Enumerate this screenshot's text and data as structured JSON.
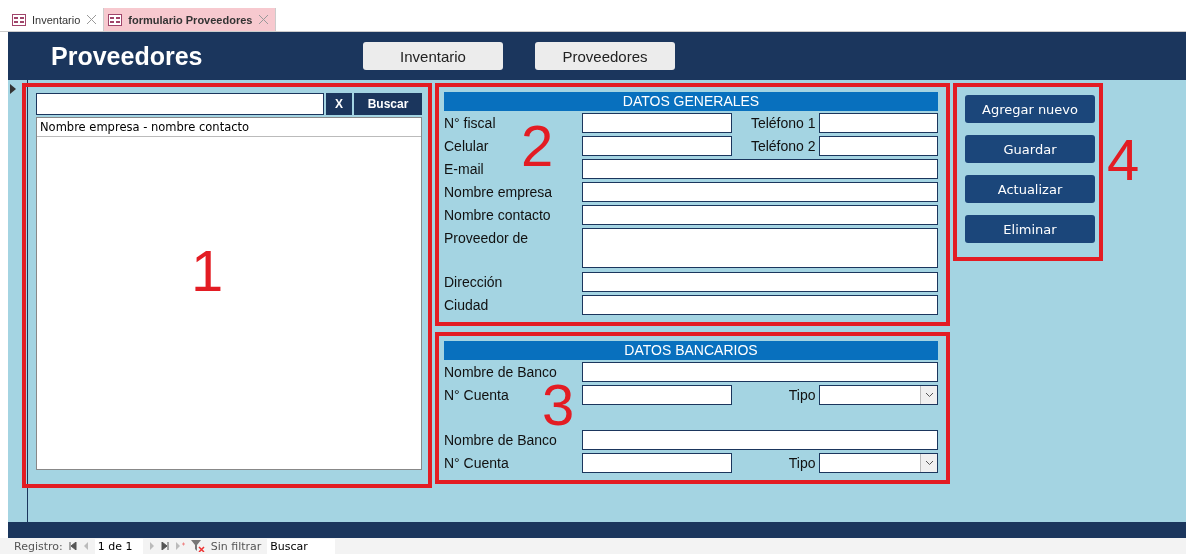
{
  "tabs": [
    {
      "label": "Inventario",
      "selected": false
    },
    {
      "label": "formulario Proveedores",
      "selected": true
    }
  ],
  "header": {
    "title": "Proveedores",
    "nav_buttons": [
      "Inventario",
      "Proveedores"
    ]
  },
  "search_panel": {
    "annotation": "1",
    "clear_button": "X",
    "search_button": "Buscar",
    "list_header": "Nombre empresa - nombre contacto"
  },
  "general": {
    "annotation": "2",
    "title": "DATOS GENERALES",
    "rows": [
      [
        {
          "label": "N° fiscal",
          "kind": "short"
        },
        {
          "label": "Teléfono 1",
          "kind": "short"
        }
      ],
      [
        {
          "label": "Celular",
          "kind": "short"
        },
        {
          "label": "Teléfono 2",
          "kind": "short"
        }
      ],
      [
        {
          "label": "E-mail",
          "kind": "long"
        }
      ],
      [
        {
          "label": "Nombre empresa",
          "kind": "long"
        }
      ],
      [
        {
          "label": "Nombre contacto",
          "kind": "long"
        }
      ],
      [
        {
          "label": "Proveedor de",
          "kind": "multiline"
        }
      ],
      [
        {
          "label": "Dirección",
          "kind": "long"
        }
      ],
      [
        {
          "label": "Ciudad",
          "kind": "long"
        }
      ]
    ]
  },
  "bank": {
    "annotation": "3",
    "title": "DATOS BANCARIOS",
    "groups": [
      [
        [
          {
            "label": "Nombre de Banco",
            "kind": "long"
          }
        ],
        [
          {
            "label": "N° Cuenta",
            "kind": "short"
          },
          {
            "label": "Tipo",
            "kind": "select"
          }
        ]
      ],
      [
        [
          {
            "label": "Nombre de Banco",
            "kind": "long"
          }
        ],
        [
          {
            "label": "N° Cuenta",
            "kind": "short"
          },
          {
            "label": "Tipo",
            "kind": "select"
          }
        ]
      ]
    ]
  },
  "actions": {
    "annotation": "4",
    "buttons": [
      "Agregar nuevo",
      "Guardar",
      "Actualizar",
      "Eliminar"
    ]
  },
  "status_bar": {
    "label": "Registro:",
    "position": "1 de 1",
    "filter": "Sin filtrar",
    "search": "Buscar"
  }
}
